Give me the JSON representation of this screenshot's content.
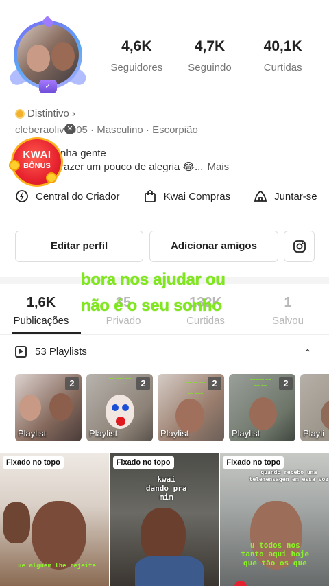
{
  "profile": {
    "avatar_badge": "✓",
    "stats": [
      {
        "value": "4,6K",
        "label": "Seguidores"
      },
      {
        "value": "4,7K",
        "label": "Seguindo"
      },
      {
        "value": "40,1K",
        "label": "Curtidas"
      }
    ],
    "distintivo": "Distintivo ›",
    "meta": "cleberaoliv   r005  ·  Masculino  ·  Escorpião",
    "bio_line1": "nha gente",
    "bio_line2": "razer um pouco de alegria 😂...",
    "bio_more": "Mais",
    "close_glyph": "✕"
  },
  "kwai_bonus": {
    "line1": "KWAI",
    "line2": "BÔNUS"
  },
  "links": [
    {
      "label": "Central do Criador",
      "icon": "lightning-circle-icon"
    },
    {
      "label": "Kwai Compras",
      "icon": "shopping-bag-icon"
    },
    {
      "label": "Juntar-se",
      "icon": "tent-icon"
    }
  ],
  "buttons": {
    "edit": "Editar perfil",
    "add": "Adicionar amigos",
    "instagram_icon": "instagram-icon"
  },
  "overlay": {
    "line1": "bora nos ajudar ou",
    "line2": "não é o seu sonho"
  },
  "tabs": [
    {
      "count": "1,6K",
      "label": "Publicações",
      "active": true
    },
    {
      "count": "35",
      "label": "Privado",
      "active": false
    },
    {
      "count": "132K",
      "label": "Curtidas",
      "active": false
    },
    {
      "count": "1",
      "label": "Salvou",
      "active": false
    }
  ],
  "playlists": {
    "header": "53 Playlists",
    "chevron": "⌃",
    "cards": [
      {
        "count": "2",
        "label": "Playlist"
      },
      {
        "count": "2",
        "label": "Playlist"
      },
      {
        "count": "2",
        "label": "Playlist"
      },
      {
        "count": "2",
        "label": "Playlist"
      },
      {
        "count": "",
        "label": "Playli"
      }
    ]
  },
  "videos": [
    {
      "pin": "Fixado no topo",
      "caption": "ue alguém lhe rejeite"
    },
    {
      "pin": "Fixado no topo",
      "caption": "kwai dando pra mim"
    },
    {
      "pin": "Fixado no topo",
      "caption_top": "quando recebo uma telemensagem em essa voz",
      "caption_bottom": "u todos nos tanto aqui hoje que tão os que"
    }
  ],
  "colors": {
    "overlay_green": "#7fe81a",
    "kwai_red": "#e7232f",
    "kwai_gold": "#ffb21e"
  }
}
